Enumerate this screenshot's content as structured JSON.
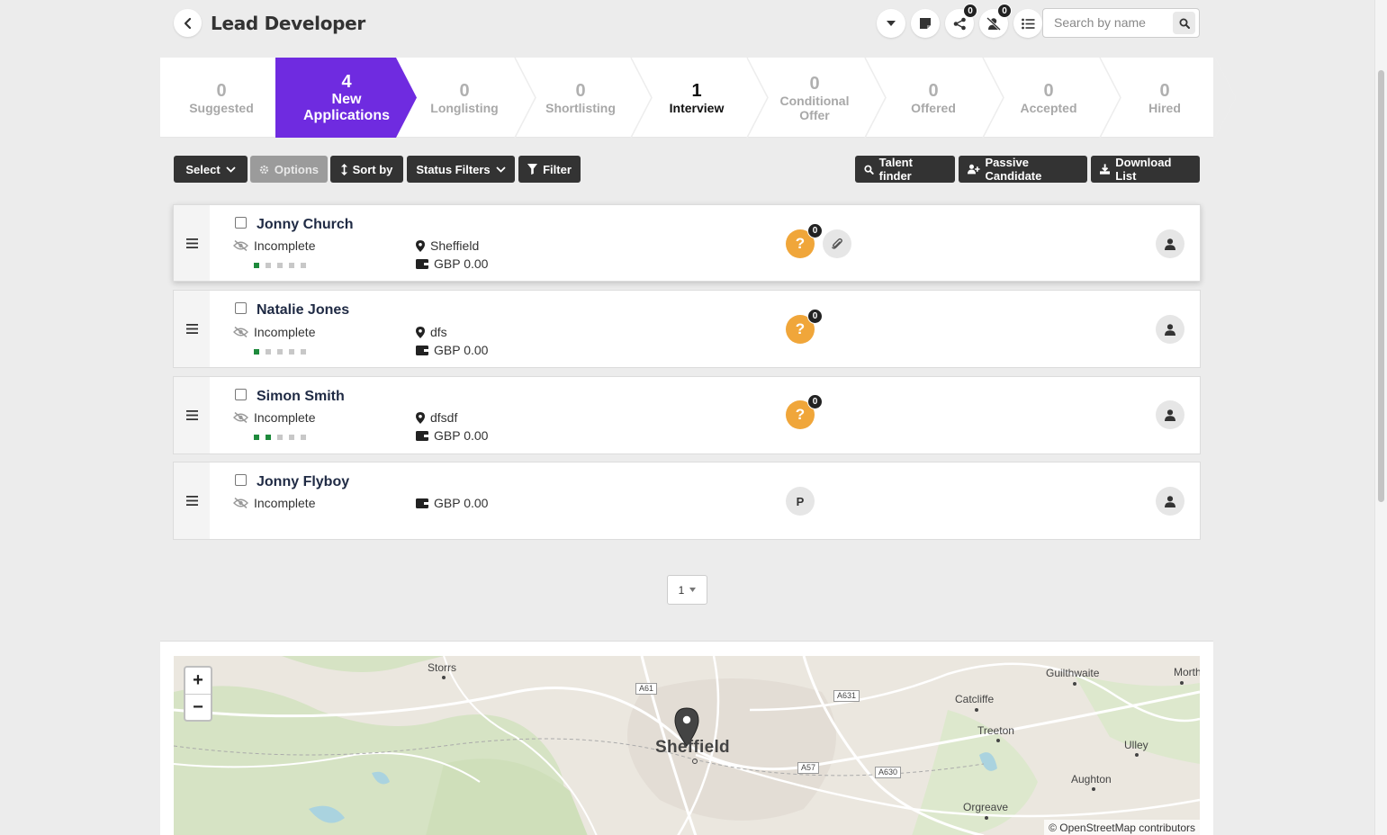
{
  "header": {
    "title": "Lead Developer",
    "icons": [
      {
        "name": "dropdown-caret-icon",
        "badge": null
      },
      {
        "name": "sticky-note-icon",
        "badge": null
      },
      {
        "name": "share-icon",
        "badge": "0"
      },
      {
        "name": "user-slash-icon",
        "badge": "0"
      },
      {
        "name": "list-icon",
        "badge": null
      }
    ],
    "search_placeholder": "Search by name"
  },
  "pipeline": [
    {
      "count": "0",
      "label": "Suggested"
    },
    {
      "count": "4",
      "label": "New Applications",
      "label_lines": [
        "New",
        "Applications"
      ]
    },
    {
      "count": "0",
      "label": "Longlisting"
    },
    {
      "count": "0",
      "label": "Shortlisting"
    },
    {
      "count": "1",
      "label": "Interview"
    },
    {
      "count": "0",
      "label": "Conditional Offer",
      "label_lines": [
        "Conditional",
        "Offer"
      ]
    },
    {
      "count": "0",
      "label": "Offered"
    },
    {
      "count": "0",
      "label": "Accepted"
    },
    {
      "count": "0",
      "label": "Hired"
    }
  ],
  "toolbar": {
    "select": "Select",
    "options": "Options",
    "sort_by": "Sort by",
    "status_filters": "Status Filters",
    "filter": "Filter",
    "talent_finder": "Talent finder",
    "passive_candidate": "Passive Candidate",
    "download_list": "Download List"
  },
  "candidates": [
    {
      "name": "Jonny Church",
      "status": "Incomplete",
      "location": "Sheffield",
      "salary": "GBP 0.00",
      "progress": 1,
      "badge": "?",
      "badge_count": "0",
      "has_attachment": true
    },
    {
      "name": "Natalie Jones",
      "status": "Incomplete",
      "location": "dfs",
      "salary": "GBP 0.00",
      "progress": 1,
      "badge": "?",
      "badge_count": "0",
      "has_attachment": false
    },
    {
      "name": "Simon Smith",
      "status": "Incomplete",
      "location": "dfsdf",
      "salary": "GBP 0.00",
      "progress": 2,
      "badge": "?",
      "badge_count": "0",
      "has_attachment": false
    },
    {
      "name": "Jonny Flyboy",
      "status": "Incomplete",
      "location": null,
      "salary": "GBP 0.00",
      "progress": null,
      "badge": "P",
      "badge_count": null,
      "has_attachment": false
    }
  ],
  "pagination": {
    "page": "1"
  },
  "map": {
    "zoom_in": "+",
    "zoom_out": "−",
    "attribution": "© OpenStreetMap contributors",
    "city": "Sheffield",
    "places": [
      "Storrs",
      "Guilthwaite",
      "Morther",
      "Catcliffe",
      "Treeton",
      "Ulley",
      "Aughton",
      "Orgreave"
    ],
    "roads": [
      "A61",
      "A631",
      "A57",
      "A630"
    ]
  },
  "colors": {
    "accent": "#6f2be0",
    "question_badge": "#f0a63a",
    "progress_on": "#1e8a3c",
    "button_dark": "#333333"
  }
}
